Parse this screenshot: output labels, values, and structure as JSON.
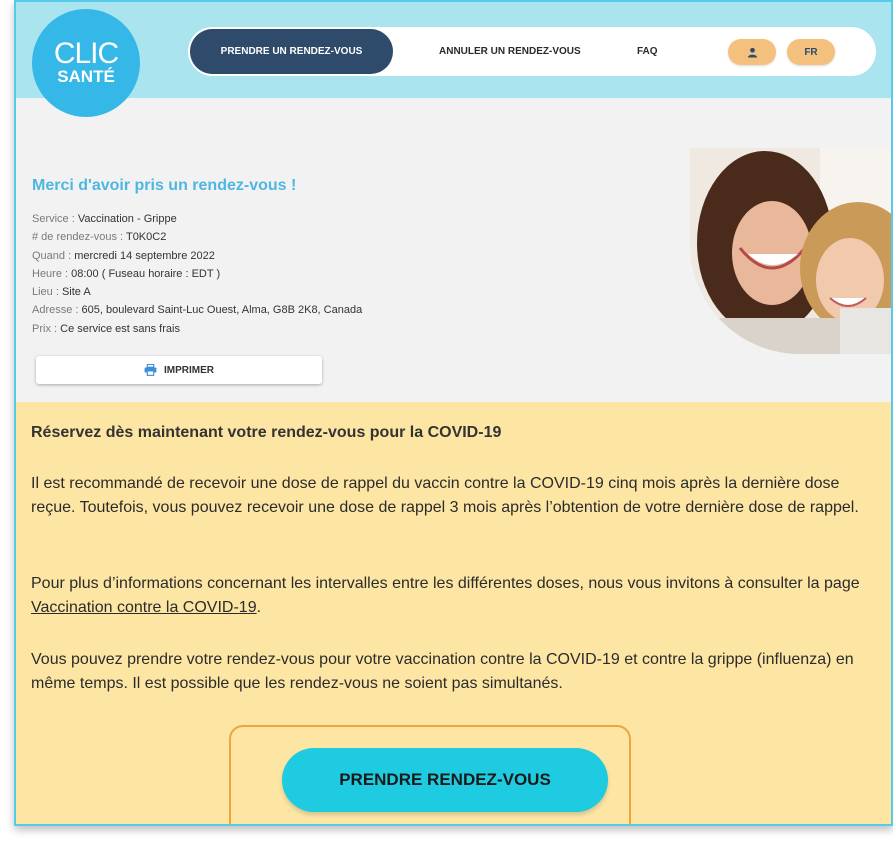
{
  "logo": {
    "line1": "CLIC",
    "line2": "SANTÉ"
  },
  "nav": {
    "active": "PRENDRE UN RENDEZ-VOUS",
    "cancel": "ANNULER UN RENDEZ-VOUS",
    "faq": "FAQ",
    "account_icon": "user-icon",
    "lang": "FR"
  },
  "confirmation": {
    "title": "Merci d'avoir pris un rendez-vous !",
    "details": [
      {
        "label": "Service : ",
        "value": "Vaccination - Grippe"
      },
      {
        "label": "# de rendez-vous : ",
        "value": "T0K0C2"
      },
      {
        "label": "Quand : ",
        "value": "mercredi 14 septembre 2022"
      },
      {
        "label": "Heure : ",
        "value": "08:00 ( Fuseau horaire : EDT )"
      },
      {
        "label": "Lieu : ",
        "value": "Site A"
      },
      {
        "label": "Adresse : ",
        "value": "605, boulevard Saint-Luc Ouest, Alma, G8B 2K8, Canada"
      },
      {
        "label": "Prix : ",
        "value": "Ce service est sans frais"
      }
    ],
    "print_label": "IMPRIMER",
    "print_icon": "printer-icon"
  },
  "covid": {
    "title": "Réservez dès maintenant votre rendez-vous pour la COVID-19",
    "p1": "Il est recommandé de recevoir une dose de rappel du vaccin contre la COVID-19 cinq mois après la dernière dose reçue. Toutefois, vous pouvez recevoir une dose de rappel 3 mois après l’obtention de votre dernière dose de rappel.",
    "p2_before": "Pour plus d’informations concernant les intervalles entre les différentes doses, nous vous invitons à consulter la page ",
    "p2_link": "Vaccination contre la COVID-19",
    "p2_after": ".",
    "p3": "Vous pouvez prendre votre rendez-vous pour votre vaccination contre la COVID-19 et contre la grippe (influenza) en même temps. Il est possible que les rendez-vous ne soient pas simultanés.",
    "cta_label": "PRENDRE RENDEZ-VOUS"
  },
  "colors": {
    "header_bg": "#a9e4ef",
    "logo_bg": "#35b8e8",
    "nav_active_bg": "#2f4b6b",
    "pill_bg": "#f4c07e",
    "title_blue": "#4fb6e3",
    "covid_bg": "#fde6a4",
    "cta_bg": "#1ecbe0",
    "highlight": "#f1a33c"
  }
}
